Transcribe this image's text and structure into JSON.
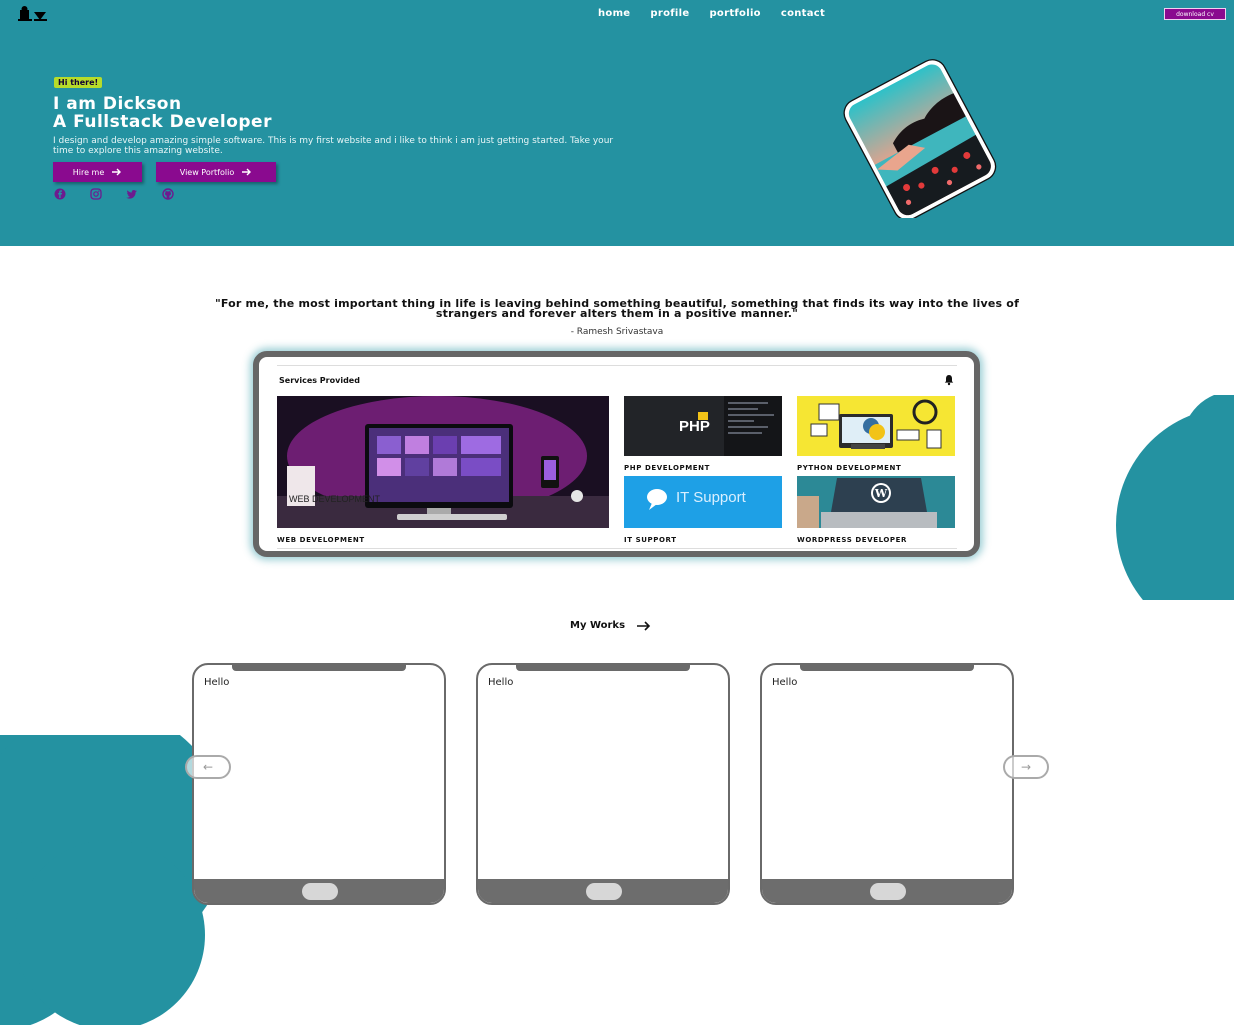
{
  "nav": {
    "links": [
      "home",
      "profile",
      "portfolio",
      "contact"
    ],
    "cv_button": "download cv"
  },
  "hero": {
    "badge": "Hi there!",
    "title_line1": "I am Dickson",
    "title_line2": "A Fullstack Developer",
    "description": "I design and develop amazing simple software. This is my first website and i like to think i am just getting started. Take your time to explore this amazing website.",
    "hire_button": "Hire me",
    "portfolio_button": "View Portfolio",
    "social_icons": [
      "facebook-icon",
      "instagram-icon",
      "twitter-icon",
      "github-icon"
    ]
  },
  "quote": {
    "text": "\"For me, the most important thing in life is leaving behind something beautiful, something that finds its way into the lives of strangers and forever alters them in a positive manner.\"",
    "author": "- Ramesh Srivastava"
  },
  "services": {
    "heading": "Services Provided",
    "items": [
      {
        "label": "WEB DEVELOPMENT",
        "overlay": "WEB DEVELOPMENT"
      },
      {
        "label": "PHP DEVELOPMENT",
        "overlay": "PHP"
      },
      {
        "label": "PYTHON DEVELOPMENT"
      },
      {
        "label": "IT SUPPORT",
        "overlay": "IT Support"
      },
      {
        "label": "WORDPRESS DEVELOPER"
      }
    ]
  },
  "works": {
    "title": "My Works",
    "cards": [
      {
        "text": "Hello"
      },
      {
        "text": "Hello"
      },
      {
        "text": "Hello"
      }
    ],
    "prev": "←",
    "next": "→"
  },
  "colors": {
    "primary": "#2492a1",
    "accent": "#8a0a8f",
    "badge": "#b7dc2a"
  }
}
